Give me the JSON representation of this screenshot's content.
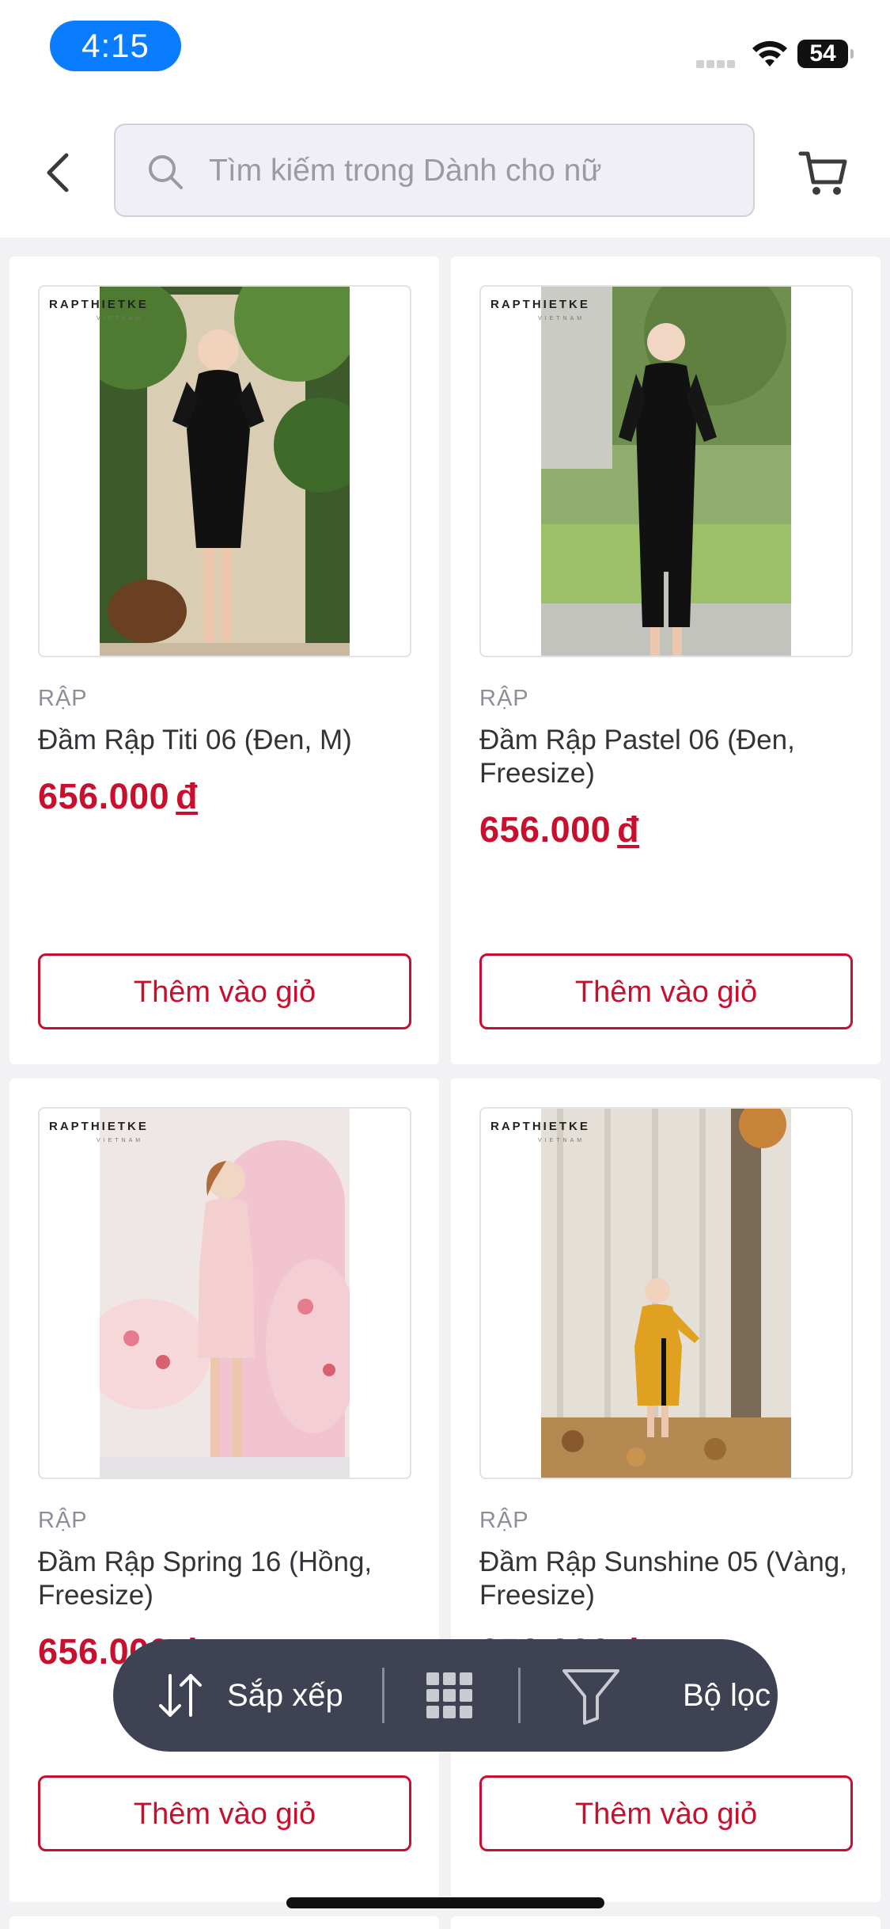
{
  "status_bar": {
    "time": "4:15",
    "battery": "54"
  },
  "header": {
    "search_placeholder": "Tìm kiếm trong Dành cho nữ"
  },
  "products": [
    {
      "category": "RẬP",
      "title": "Đầm Rập Titi 06 (Đen, M)",
      "price": "656.000",
      "currency": "đ",
      "button": "Thêm vào giỏ",
      "brand": "RAPTHIETKE",
      "brand_sub": "VIETNAM"
    },
    {
      "category": "RẬP",
      "title": "Đầm Rập Pastel 06 (Đen, Freesize)",
      "price": "656.000",
      "currency": "đ",
      "button": "Thêm vào giỏ",
      "brand": "RAPTHIETKE",
      "brand_sub": "VIETNAM"
    },
    {
      "category": "RẬP",
      "title": "Đầm Rập Spring 16 (Hồng, Freesize)",
      "price": "656.000",
      "currency": "đ",
      "button": "Thêm vào giỏ",
      "brand": "RAPTHIETKE",
      "brand_sub": "VIETNAM"
    },
    {
      "category": "RẬP",
      "title": "Đầm Rập Sunshine 05 (Vàng, Freesize)",
      "price": "656.000",
      "currency": "đ",
      "button": "Thêm vào giỏ",
      "brand": "RAPTHIETKE",
      "brand_sub": "VIETNAM"
    }
  ],
  "toolbar": {
    "sort_label": "Sắp xếp",
    "filter_label": "Bộ lọc"
  },
  "colors": {
    "accent": "#c8102e",
    "time_pill": "#0a7cff",
    "toolbar_bg": "#3e4252"
  },
  "icons": [
    "back-icon",
    "search-icon",
    "cart-icon",
    "sort-icon",
    "grid-icon",
    "filter-icon",
    "wifi-icon",
    "battery-icon"
  ]
}
